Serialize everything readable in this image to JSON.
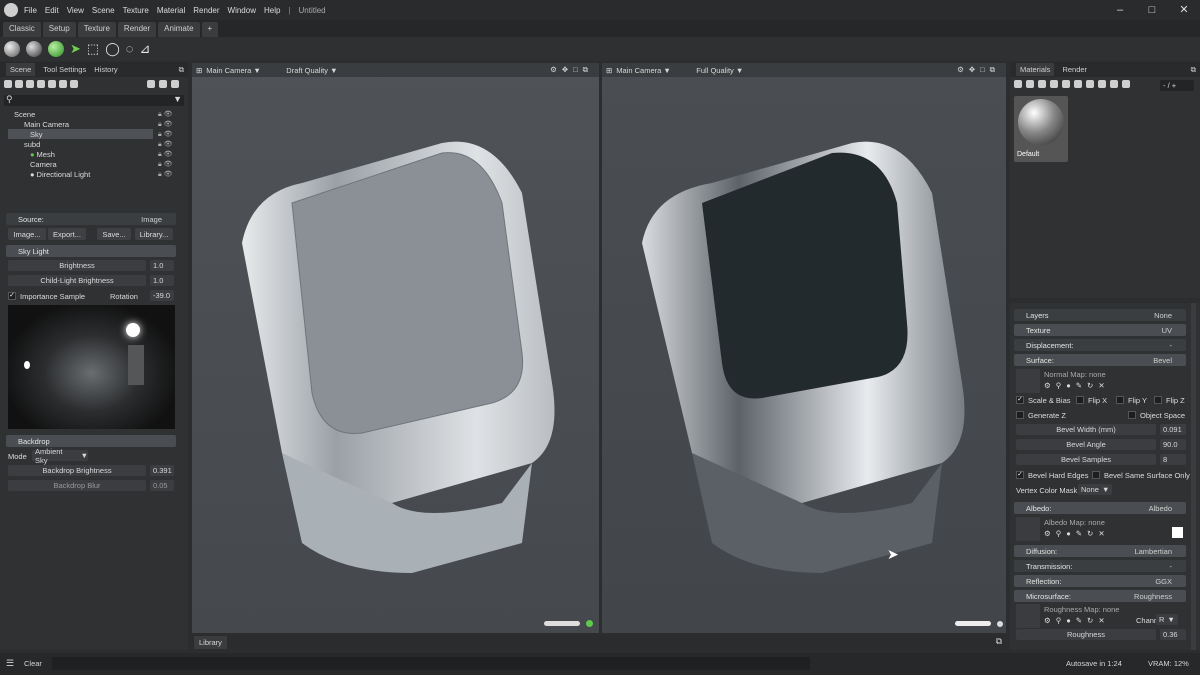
{
  "titlebar": {
    "menus": [
      "File",
      "Edit",
      "View",
      "Scene",
      "Texture",
      "Material",
      "Render",
      "Window",
      "Help"
    ],
    "doc_title": "Untitled"
  },
  "mode_tabs": [
    "Classic",
    "Setup",
    "Texture",
    "Render",
    "Animate",
    "+"
  ],
  "scene_panel": {
    "tabs": [
      "Scene",
      "Tool Settings",
      "History"
    ],
    "tree": [
      "Scene",
      "Main Camera",
      "Sky",
      "subd",
      "Mesh",
      "Camera",
      "Directional Light"
    ]
  },
  "sky_panel": {
    "source_label": "Source:",
    "source_value": "Image",
    "buttons": [
      "Image...",
      "Export...",
      "Save...",
      "Library..."
    ],
    "section": "Sky Light",
    "brightness_label": "Brightness",
    "brightness": "1.0",
    "child_light_label": "Child-Light Brightness",
    "child_light": "1.0",
    "importance_label": "Importance Sample",
    "rotation_label": "Rotation",
    "rotation": "-39.0",
    "backdrop_section": "Backdrop",
    "mode_label": "Mode",
    "mode_value": "Ambient Sky",
    "backdrop_brightness_label": "Backdrop Brightness",
    "backdrop_brightness": "0.391",
    "backdrop_blur_label": "Backdrop Blur",
    "backdrop_blur": "0.05"
  },
  "viewport_left": {
    "camera": "Main Camera",
    "quality": "Draft Quality"
  },
  "viewport_right": {
    "camera": "Main Camera",
    "quality": "Full Quality"
  },
  "library_tab": "Library",
  "materials_panel": {
    "tabs": [
      "Materials",
      "Render"
    ],
    "search": "- / +",
    "material_name": "Default"
  },
  "properties": {
    "layers_label": "Layers",
    "layers_value": "None",
    "texture_label": "Texture",
    "texture_value": "UV",
    "displacement_label": "Displacement:",
    "displacement_value": "-",
    "surface_label": "Surface:",
    "surface_value": "Bevel",
    "normal_map": "Normal Map: none",
    "scale_bias": "Scale & Bias",
    "flip_x": "Flip X",
    "flip_y": "Flip Y",
    "flip_z": "Flip Z",
    "generate_z": "Generate Z",
    "object_space": "Object Space",
    "bevel_width_label": "Bevel Width (mm)",
    "bevel_width": "0.091",
    "bevel_angle_label": "Bevel Angle",
    "bevel_angle": "90.0",
    "bevel_samples_label": "Bevel Samples",
    "bevel_samples": "8",
    "hard_edges": "Bevel Hard Edges",
    "same_surface": "Bevel Same Surface Only",
    "vcm_label": "Vertex Color Mask",
    "vcm_value": "None",
    "albedo_label": "Albedo:",
    "albedo_value": "Albedo",
    "albedo_map": "Albedo Map: none",
    "diffusion_label": "Diffusion:",
    "diffusion_value": "Lambertian",
    "transmission_label": "Transmission:",
    "transmission_value": "-",
    "reflection_label": "Reflection:",
    "reflection_value": "GGX",
    "microsurface_label": "Microsurface:",
    "microsurface_value": "Roughness",
    "roughness_map": "Roughness Map: none",
    "channel_label": "Channel",
    "channel_value": "R",
    "roughness_label": "Roughness",
    "roughness": "0.36"
  },
  "statusbar": {
    "clear": "Clear",
    "autosave": "Autosave in 1:24",
    "vram": "VRAM: 12%"
  },
  "colors": {
    "accent_green": "#5fc94a",
    "panel": "#2f3133",
    "viewport": "#4b4f53"
  }
}
